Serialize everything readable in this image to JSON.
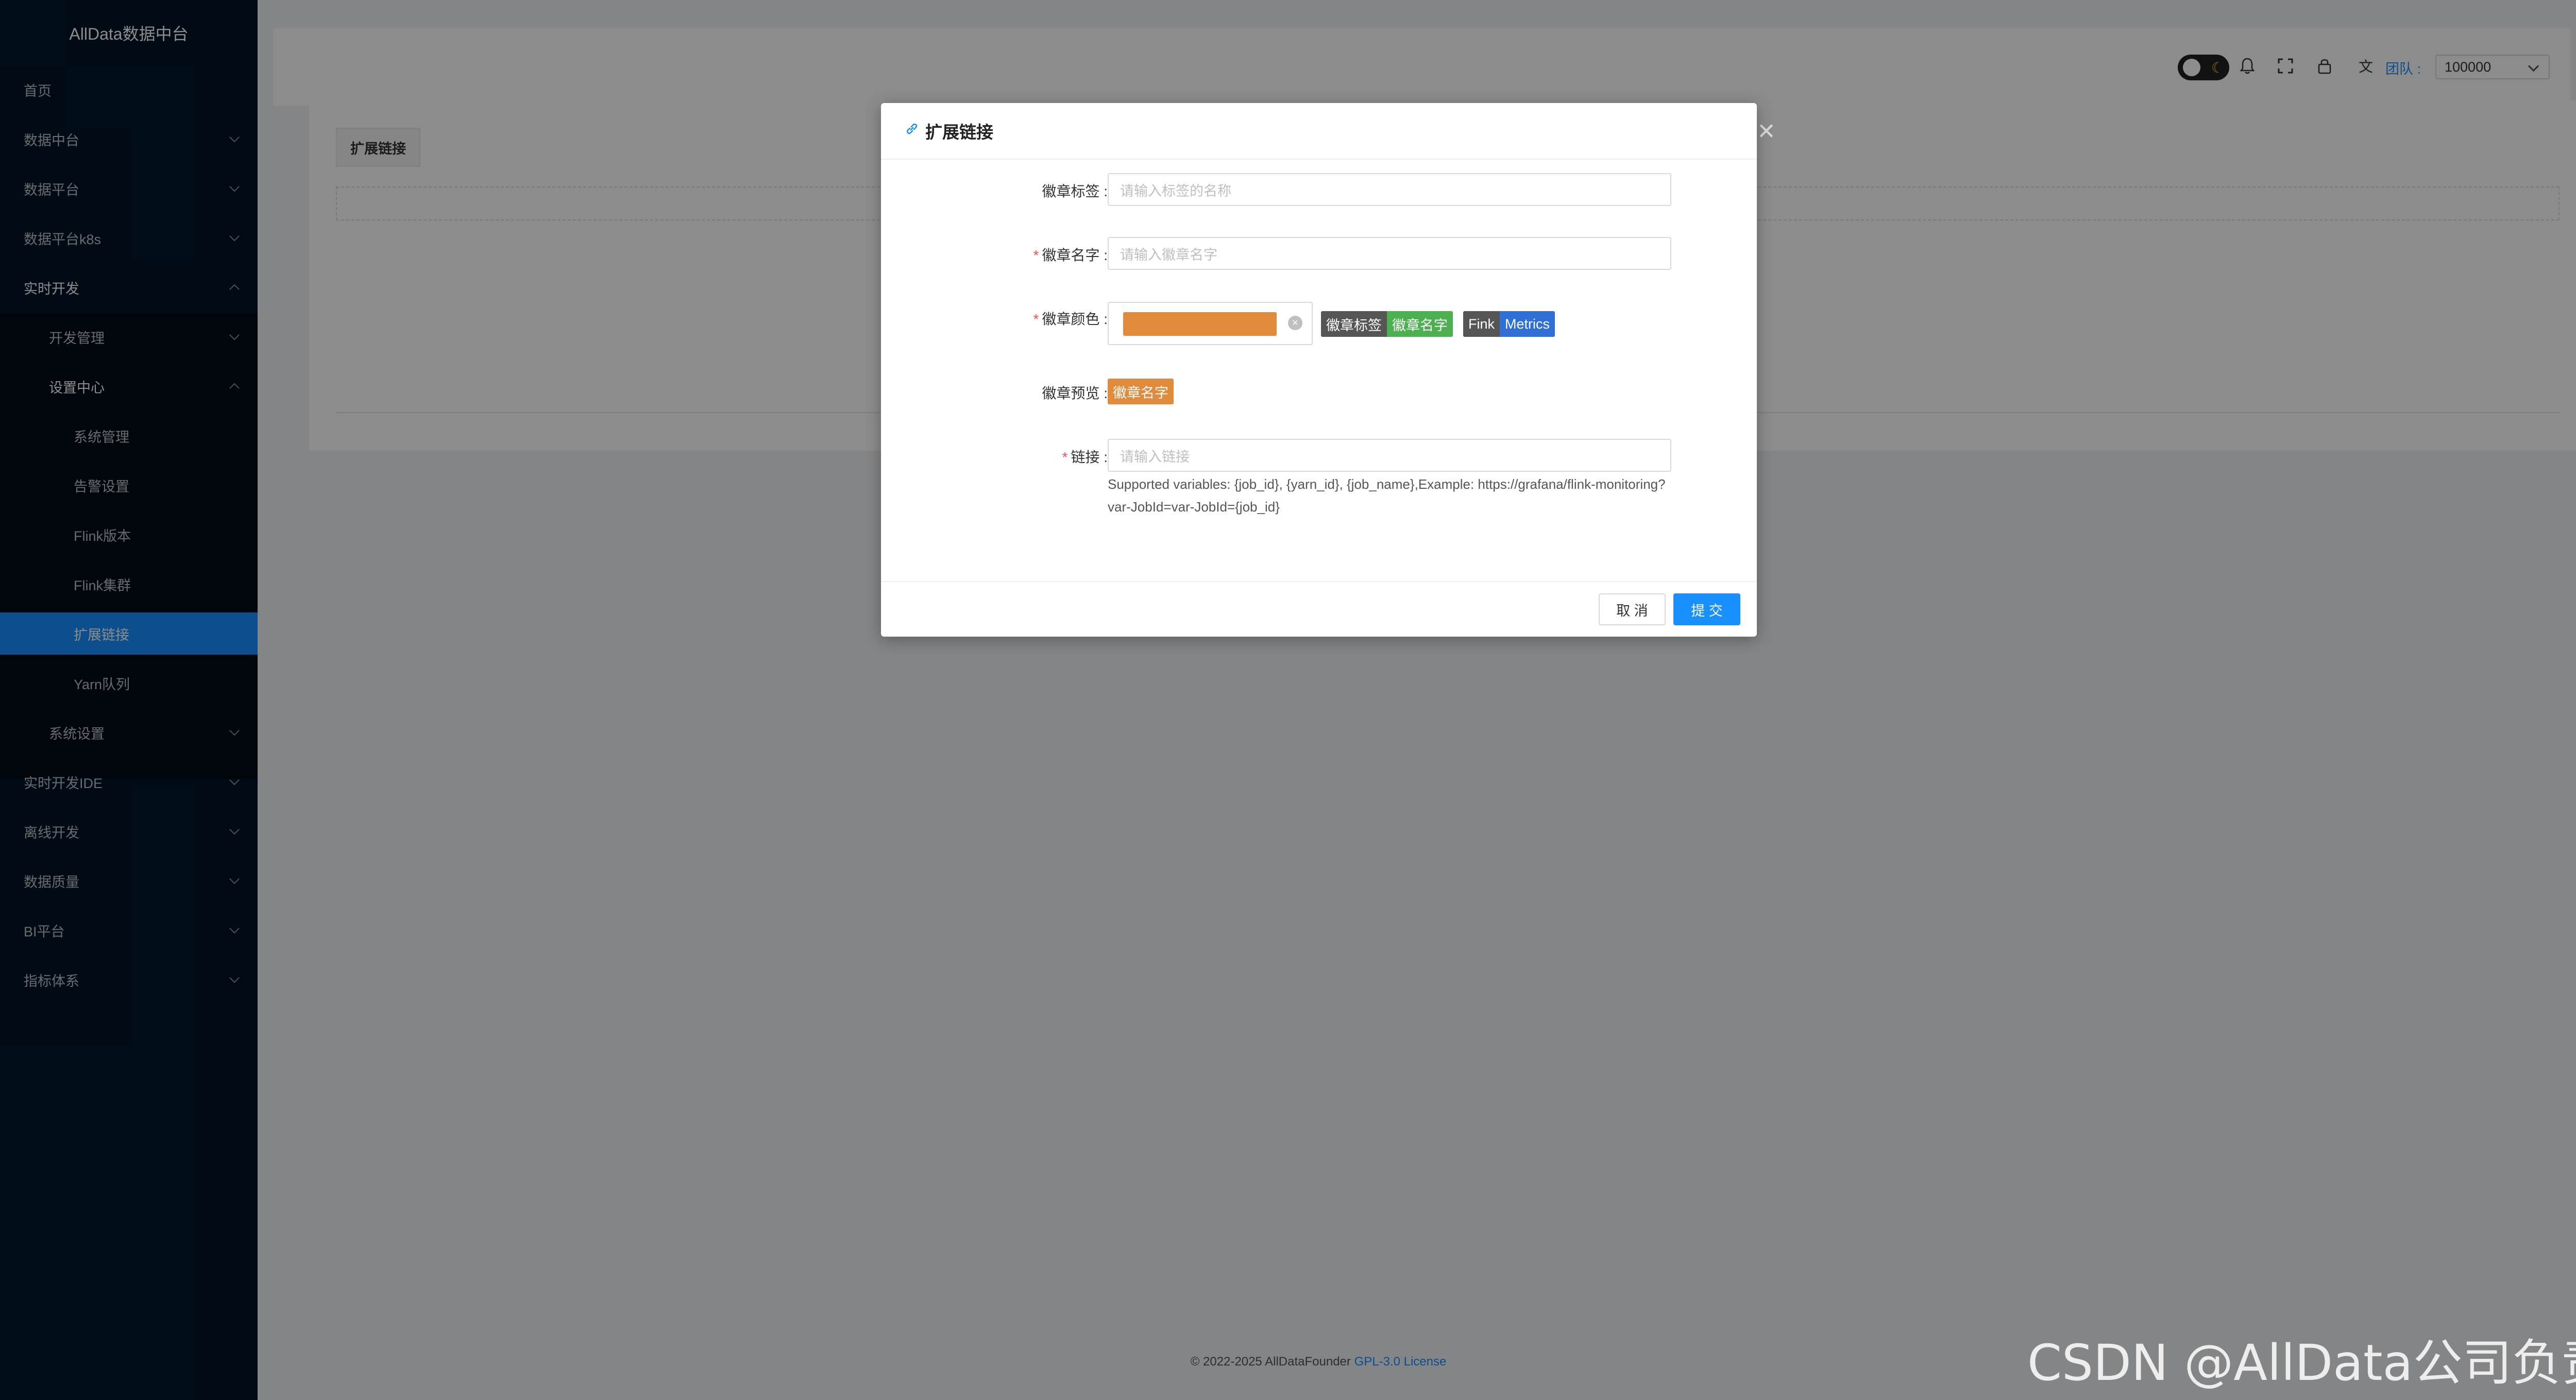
{
  "app": {
    "title": "AllData数据中台"
  },
  "sidebar": {
    "items": [
      {
        "label": "首页"
      },
      {
        "label": "数据中台"
      },
      {
        "label": "数据平台"
      },
      {
        "label": "数据平台k8s"
      },
      {
        "label": "实时开发"
      },
      {
        "label": "开发管理"
      },
      {
        "label": "设置中心"
      },
      {
        "label": "系统管理"
      },
      {
        "label": "告警设置"
      },
      {
        "label": "Flink版本"
      },
      {
        "label": "Flink集群"
      },
      {
        "label": "扩展链接"
      },
      {
        "label": "Yarn队列"
      },
      {
        "label": "系统设置"
      },
      {
        "label": "实时开发IDE"
      },
      {
        "label": "离线开发"
      },
      {
        "label": "数据质量"
      },
      {
        "label": "BI平台"
      },
      {
        "label": "指标体系"
      }
    ]
  },
  "header": {
    "team_label": "团队 :",
    "team_value": "100000"
  },
  "page": {
    "tab_label": "扩展链接"
  },
  "modal": {
    "title": "扩展链接",
    "badge_label_label": "徽章标签 :",
    "badge_label_placeholder": "请输入标签的名称",
    "badge_name_label": "徽章名字 :",
    "badge_name_placeholder": "请输入徽章名字",
    "badge_color_label": "徽章颜色 :",
    "badge_color_value": "#e08a3c",
    "sample_badge_1": {
      "left": "徽章标签",
      "right": "徽章名字",
      "left_color": "#555555",
      "right_color": "#4caf50"
    },
    "sample_badge_2": {
      "left": "Fink",
      "right": "Metrics",
      "left_color": "#555555",
      "right_color": "#2f6fd6"
    },
    "preview_label": "徽章预览 :",
    "preview_badge": "徽章名字",
    "link_label": "链接 :",
    "link_placeholder": "请输入链接",
    "helper_text": "Supported variables: {job_id}, {yarn_id}, {job_name},Example: https://grafana/flink-monitoring?var-JobId=var-JobId={job_id}",
    "cancel_label": "取 消",
    "submit_label": "提 交"
  },
  "footer": {
    "copyright": "© 2022-2025 AllDataFounder",
    "license": "GPL-3.0 License"
  },
  "watermark": "CSDN @AllData公司负责人"
}
